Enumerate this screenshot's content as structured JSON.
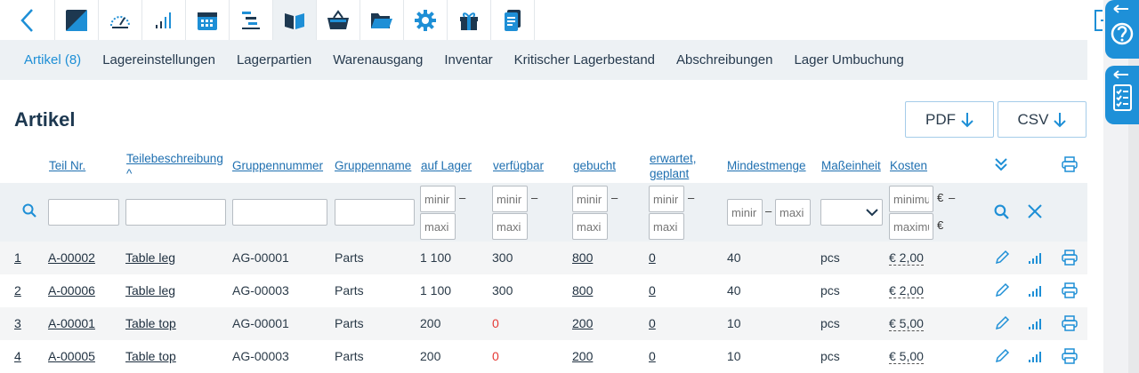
{
  "toolbar": {
    "icons": [
      "back-chevron-icon",
      "brand-logo-icon",
      "gauge-icon",
      "bar-signal-icon",
      "calendar-icon",
      "gantt-icon",
      "book-icon",
      "basket-icon",
      "folder-icon",
      "gear-icon",
      "gift-icon",
      "document-icon"
    ],
    "active_index": 6,
    "logout_icon": "logout-icon"
  },
  "side_tabs": [
    "help-icon",
    "checklist-icon"
  ],
  "nav": {
    "items": [
      "Artikel (8)",
      "Lagereinstellungen",
      "Lagerpartien",
      "Warenausgang",
      "Inventar",
      "Kritischer Lagerbestand",
      "Abschreibungen",
      "Lager Umbuchung"
    ],
    "active": 0
  },
  "page": {
    "title": "Artikel"
  },
  "export": {
    "pdf": "PDF",
    "csv": "CSV"
  },
  "table": {
    "headers": {
      "teil_nr": "Teil Nr.",
      "beschreibung": "Teilebeschreibung",
      "sort_indicator": "^",
      "gruppennummer": "Gruppennummer",
      "gruppenname": "Gruppenname",
      "auf_lager": "auf Lager",
      "verfuegbar": "verfügbar",
      "gebucht": "gebucht",
      "erwartet_1": "erwartet,",
      "erwartet_2": "geplant",
      "mindestmenge": "Mindestmenge",
      "masseinheit": "Maßeinheit",
      "kosten": "Kosten"
    },
    "filter": {
      "min_placeholder": "minimum",
      "max_placeholder": "maximum",
      "min_short": "minir",
      "max_short": "maxi",
      "mind_max": "maxi",
      "dash": "–",
      "currency": "€"
    },
    "rows": [
      {
        "nr": "1",
        "teil": "A-00002",
        "beschr": "Table leg",
        "gnum": "AG-00001",
        "gname": "Parts",
        "lager": "1 100",
        "verf": "300",
        "geb": "800",
        "erw": "0",
        "mind": "40",
        "einheit": "pcs",
        "kosten": "€ 2,00"
      },
      {
        "nr": "2",
        "teil": "A-00006",
        "beschr": "Table leg",
        "gnum": "AG-00003",
        "gname": "Parts",
        "lager": "1 100",
        "verf": "300",
        "geb": "800",
        "erw": "0",
        "mind": "40",
        "einheit": "pcs",
        "kosten": "€ 2,00"
      },
      {
        "nr": "3",
        "teil": "A-00001",
        "beschr": "Table top",
        "gnum": "AG-00001",
        "gname": "Parts",
        "lager": "200",
        "verf": "0",
        "geb": "200",
        "erw": "0",
        "mind": "10",
        "einheit": "pcs",
        "kosten": "€ 5,00"
      },
      {
        "nr": "4",
        "teil": "A-00005",
        "beschr": "Table top",
        "gnum": "AG-00003",
        "gname": "Parts",
        "lager": "200",
        "verf": "0",
        "geb": "200",
        "erw": "0",
        "mind": "10",
        "einheit": "pcs",
        "kosten": "€ 5,00"
      }
    ]
  },
  "colors": {
    "accent": "#1e8fd6",
    "nav_bg": "#edf1f4",
    "negative": "#e53935",
    "brand_dark": "#1d3850"
  }
}
